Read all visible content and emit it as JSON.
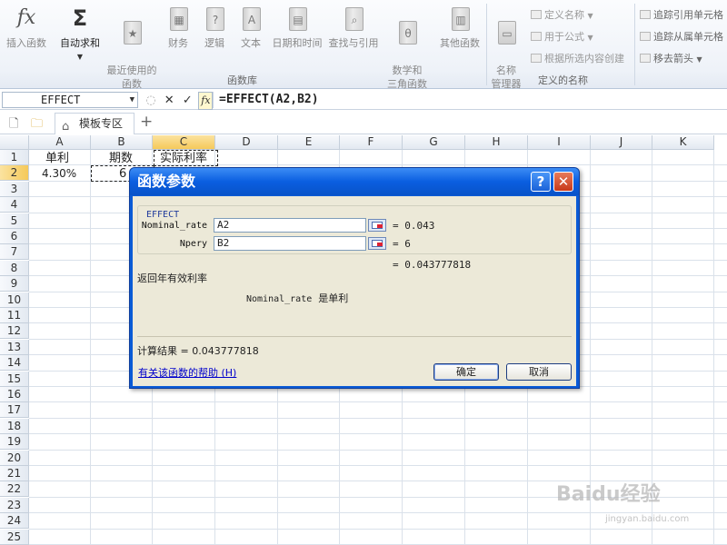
{
  "ribbon": {
    "buttons": [
      {
        "label": "插入函数",
        "icon": "fx-icon"
      },
      {
        "label": "自动求和",
        "icon": "sigma-icon"
      },
      {
        "label": "最近使用的\n函数",
        "icon": "book-star-icon"
      },
      {
        "label": "财务",
        "icon": "book-finance-icon"
      },
      {
        "label": "逻辑",
        "icon": "book-logic-icon"
      },
      {
        "label": "文本",
        "icon": "book-text-icon"
      },
      {
        "label": "日期和时间",
        "icon": "book-date-icon"
      },
      {
        "label": "查找与引用",
        "icon": "book-lookup-icon"
      },
      {
        "label": "数学和\n三角函数",
        "icon": "book-math-icon"
      },
      {
        "label": "其他函数",
        "icon": "book-more-icon"
      }
    ],
    "function_library_label": "函数库",
    "name_manager_label": "名称\n管理器",
    "define_name": "定义名称",
    "use_in_formula": "用于公式",
    "create_from_selection": "根据所选内容创建",
    "defined_names_label": "定义的名称",
    "trace_precedents": "追踪引用单元格",
    "trace_dependents": "追踪从属单元格",
    "remove_arrows": "移去箭头"
  },
  "formula_bar": {
    "name_box": "EFFECT",
    "formula": "=EFFECT(A2,B2)"
  },
  "tabs": {
    "template_zone": "模板专区"
  },
  "columns": [
    "A",
    "B",
    "C",
    "D",
    "E",
    "F",
    "G",
    "H",
    "I",
    "J",
    "K"
  ],
  "rows": [
    "1",
    "2",
    "3",
    "4",
    "5",
    "6",
    "7",
    "8",
    "9",
    "10",
    "11",
    "12",
    "13",
    "14",
    "15",
    "16",
    "17",
    "18",
    "19",
    "20",
    "21",
    "22",
    "23",
    "24",
    "25"
  ],
  "cells": {
    "A1": "单利",
    "B1": "期数",
    "C1": "实际利率",
    "A2": "4.30%",
    "B2": "6"
  },
  "dialog": {
    "title": "函数参数",
    "function_name": "EFFECT",
    "args": [
      {
        "name": "Nominal_rate",
        "value": "A2",
        "result": "= 0.043"
      },
      {
        "name": "Npery",
        "value": "B2",
        "result": "= 6"
      }
    ],
    "formula_result_inline": "= 0.043777818",
    "description": "返回年有效利率",
    "arg_description_name": "Nominal_rate",
    "arg_description_text": "是单利",
    "calc_result_label": "计算结果 = ",
    "calc_result_value": "0.043777818",
    "help_link": "有关该函数的帮助 (H)",
    "ok": "确定",
    "cancel": "取消",
    "help_btn": "?",
    "close_btn": "✕"
  },
  "watermark": {
    "brand": "Baidu经验",
    "url": "jingyan.baidu.com"
  },
  "colors": {
    "dialog_title_blue": "#0a5ee0",
    "selected_header": "#f5c95a",
    "dialog_bg": "#ece9d8"
  }
}
